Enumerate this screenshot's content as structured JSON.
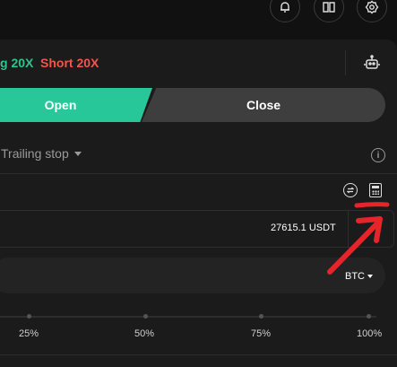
{
  "header": {
    "icons": [
      "alarm-icon",
      "book-icon",
      "settings-icon"
    ]
  },
  "leverage": {
    "long_label": "g 20X",
    "short_label": "Short 20X",
    "long_color": "#28c790",
    "short_color": "#f2554b"
  },
  "tabs": {
    "open": "Open",
    "close": "Close",
    "open_color": "#27c79a"
  },
  "order_type": {
    "selected": "Trailing stop",
    "info_glyph": "i"
  },
  "price": {
    "value": "27615.1 USDT"
  },
  "amount": {
    "unit_selected": "BTC"
  },
  "slider": {
    "marks": [
      "25%",
      "50%",
      "75%",
      "100%"
    ]
  },
  "annotation": {
    "color": "#e5252a",
    "target": "calculator-icon"
  }
}
